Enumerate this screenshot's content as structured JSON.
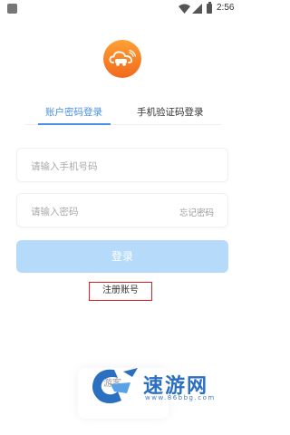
{
  "status_bar": {
    "time": "2:56"
  },
  "tabs": {
    "password_login": "账户密码登录",
    "sms_login": "手机验证码登录",
    "active": "password_login"
  },
  "form": {
    "phone_placeholder": "请输入手机号码",
    "password_placeholder": "请输入密码",
    "forgot_password": "忘记密码"
  },
  "login_button": "登录",
  "register_link": "注册账号",
  "bottom_text": "游客",
  "watermark": {
    "title": "速游网",
    "url": "www.86bbg.com"
  },
  "colors": {
    "accent": "#4a90e2",
    "button_disabled": "#b6dafa",
    "logo_orange": "#f47b24",
    "highlight_box": "#e02020"
  },
  "icons": {
    "logo": "cloud-car-icon",
    "wifi": "wifi-icon",
    "signal": "cell-signal-icon",
    "battery": "battery-icon"
  }
}
